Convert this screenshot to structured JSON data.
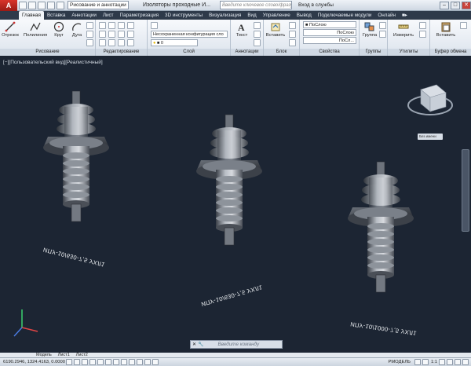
{
  "titlebar": {
    "app_logo": "A",
    "workspace": "Рисование и аннотации",
    "doc_title": "Изоляторы проходные И...",
    "search_placeholder": "Введите ключевое слово/фразу",
    "signin": "Вход в службы",
    "minimize": "–",
    "restore": "□",
    "close": "✕"
  },
  "tabs": [
    "Главная",
    "Вставка",
    "Аннотации",
    "Лист",
    "Параметризация",
    "3D инструменты",
    "Визуализация",
    "Вид",
    "Управление",
    "Вывод",
    "Подключаемые модули",
    "Онлайн",
    "■▸"
  ],
  "ribbon": {
    "draw": {
      "label": "Рисование",
      "line": "Отрезок",
      "polyline": "Полилиния",
      "circle": "Круг",
      "arc": "Дуга"
    },
    "modify": {
      "label": "Редактирование"
    },
    "layers": {
      "label": "Слой",
      "state": "Несохраненная конфигурация сло",
      "current": "0"
    },
    "annotation": {
      "label": "Аннотации",
      "text": "Текст"
    },
    "block": {
      "label": "Блок",
      "insert": "Вставить"
    },
    "properties": {
      "label": "Свойства",
      "color": "ПоСлою",
      "linetype": "ПоСлою",
      "lineweight": "ПоСл..."
    },
    "groups": {
      "label": "Группы",
      "group": "Группа"
    },
    "utilities": {
      "label": "Утилиты",
      "measure": "Измерить"
    },
    "clipboard": {
      "label": "Буфер обмена",
      "paste": "Вставить"
    }
  },
  "viewport": {
    "label": "[−][Пользовательский вид][Реалистичный]",
    "viewcube_tip": "Без имени",
    "parts": [
      {
        "label": "ИПУ-10/630-7,5 УХЛ1"
      },
      {
        "label": "ИПУ-10/630-7,5 УХЛ1"
      },
      {
        "label": "ИПУ-10/1000-7,5 УХЛ1"
      }
    ]
  },
  "command": {
    "placeholder": "Введите команду"
  },
  "layout_tabs": [
    "Модель",
    "Лист1",
    "Лист2"
  ],
  "status": {
    "coords": "6190.2946, 1324.4163, 0.0000",
    "model": "РМОДЕЛЬ",
    "scale": "1:1"
  }
}
